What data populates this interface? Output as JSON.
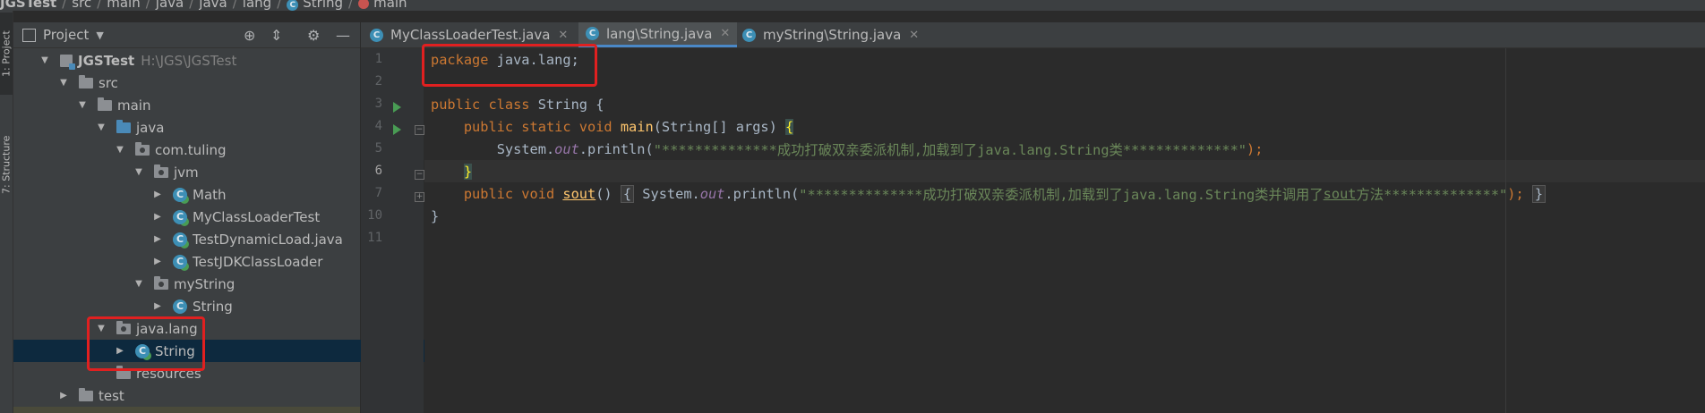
{
  "breadcrumb": [
    "JGSTest",
    "src",
    "main",
    "java",
    "java",
    "lang",
    "String",
    "main"
  ],
  "left_strip": {
    "project_tab": "1: Project",
    "structure_tab": "7: Structure"
  },
  "project_panel": {
    "title": "Project",
    "tree": [
      {
        "label": "JGSTest",
        "path": "H:\\JGS\\JGSTest"
      },
      {
        "label": "src"
      },
      {
        "label": "main"
      },
      {
        "label": "java"
      },
      {
        "label": "com.tuling"
      },
      {
        "label": "jvm"
      },
      {
        "label": "Math"
      },
      {
        "label": "MyClassLoaderTest"
      },
      {
        "label": "TestDynamicLoad.java"
      },
      {
        "label": "TestJDKClassLoader"
      },
      {
        "label": "myString"
      },
      {
        "label": "String"
      },
      {
        "label": "java.lang"
      },
      {
        "label": "String"
      },
      {
        "label": "resources"
      },
      {
        "label": "test"
      }
    ]
  },
  "editor": {
    "tabs": [
      {
        "label": "MyClassLoaderTest.java"
      },
      {
        "label": "lang\\String.java",
        "active": true
      },
      {
        "label": "myString\\String.java"
      }
    ],
    "line_numbers": [
      "1",
      "2",
      "3",
      "4",
      "5",
      "6",
      "7",
      "10",
      "11"
    ],
    "code": {
      "l1_kw": "package",
      "l1_rest": " java.lang;",
      "l3_kw": "public class",
      "l3_rest": " String {",
      "l4_kw": "public static void",
      "l4_fn": "main",
      "l4_rest": "(String[] args) ",
      "l4_brace": "{",
      "l5_a": "System.",
      "l5_field": "out",
      "l5_b": ".println(",
      "l5_str": "\"**************成功打破双亲委派机制,加载到了java.lang.String类**************\"",
      "l5_end": ");",
      "l6_brace": "}",
      "l7_kw": "public void",
      "l7_fn": "sout",
      "l7_paren": "() ",
      "l7_open": "{",
      "l7_a": " System.",
      "l7_field": "out",
      "l7_b": ".println(",
      "l7_str1": "\"**************成功打破双亲委派机制,加载到了java.lang.String类并调用了",
      "l7_str_ul": "sout",
      "l7_str2": "方法**************\"",
      "l7_end": "); ",
      "l7_close": "}",
      "l10": "}"
    }
  },
  "colors": {
    "background": "#2b2b2b",
    "keyword": "#cc7832",
    "string": "#6a8759",
    "field": "#9876aa",
    "method": "#ffc66d",
    "highlight_box": "#e02020",
    "selection": "#0d293e"
  }
}
